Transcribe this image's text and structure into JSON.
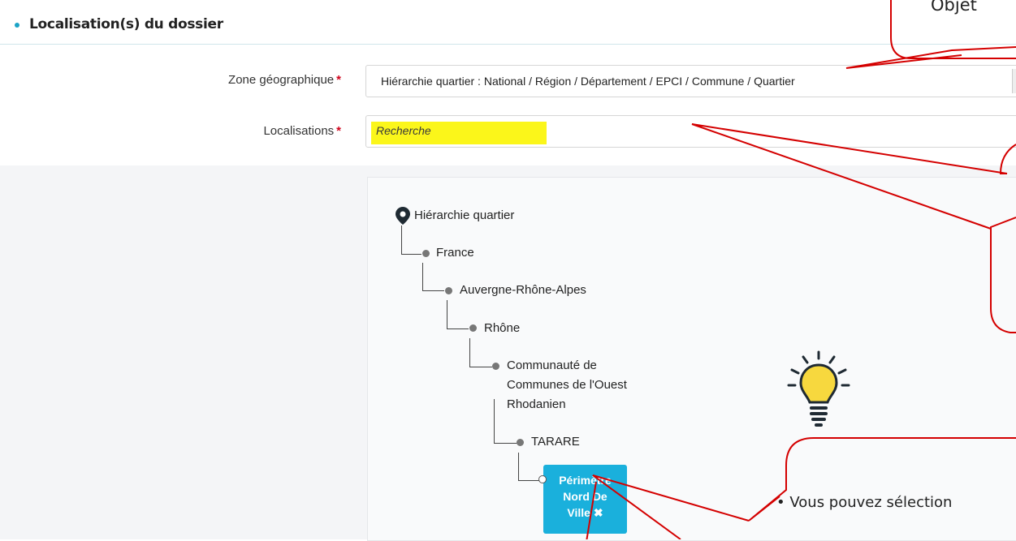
{
  "section": {
    "title": "Localisation(s) du dossier"
  },
  "zone": {
    "label": "Zone géographique",
    "required_mark": "*",
    "value": "Hiérarchie quartier : National / Région / Département / EPCI / Commune / Quartier"
  },
  "localisations": {
    "label": "Localisations",
    "required_mark": "*",
    "placeholder": "Recherche"
  },
  "tree": {
    "root": "Hiérarchie quartier",
    "nodes": [
      "France",
      "Auvergne-Rhône-Alpes",
      "Rhône",
      "Communauté de",
      "Communes de l'Ouest",
      "Rhodanien",
      "TARARE"
    ],
    "selected": {
      "line1": "Périmètre",
      "line2": "Nord De",
      "line3": "Ville",
      "remove": "✖"
    }
  },
  "callouts": {
    "top_partial": "Objet",
    "bottom_bullet": "•",
    "bottom_text": "Vous  pouvez sélection"
  },
  "colors": {
    "accent": "#1ab0dc",
    "callout_red": "#d40000",
    "highlight": "#fbf61a",
    "bulb": "#f7d83e"
  }
}
